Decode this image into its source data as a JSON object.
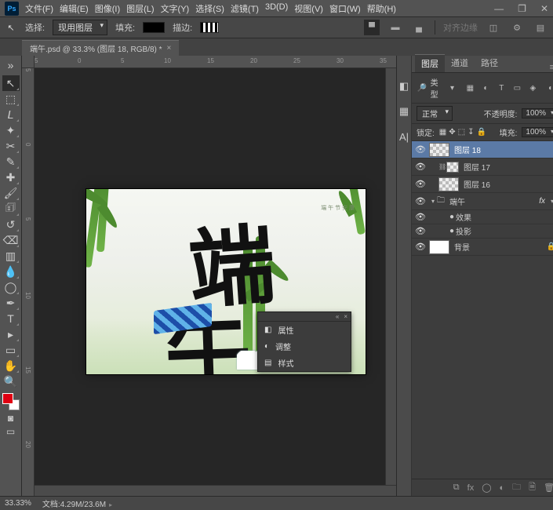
{
  "app": {
    "logo": "Ps"
  },
  "menu": [
    "文件(F)",
    "编辑(E)",
    "图像(I)",
    "图层(L)",
    "文字(Y)",
    "选择(S)",
    "滤镜(T)",
    "3D(D)",
    "视图(V)",
    "窗口(W)",
    "帮助(H)"
  ],
  "window_controls": {
    "min": "—",
    "restore": "❐",
    "close": "✕"
  },
  "options": {
    "select_label": "选择:",
    "select_value": "现用图层",
    "fill_label": "填充:",
    "stroke_label": "描边:",
    "quick_export": "对齐边缘"
  },
  "doc_tab": {
    "title": "端午.psd @ 33.3% (图层 18, RGB/8) *"
  },
  "ruler_h": [
    "5",
    "0",
    "5",
    "10",
    "15",
    "20",
    "25",
    "30",
    "35"
  ],
  "ruler_v": [
    "5",
    "0",
    "5",
    "10",
    "15",
    "20"
  ],
  "canvas": {
    "char1": "端",
    "char2": "午",
    "sidecol": "端\n午\n节\n安\n康"
  },
  "floater": {
    "items": [
      {
        "icon": "properties-icon",
        "label": "属性"
      },
      {
        "icon": "adjustments-icon",
        "label": "调整"
      },
      {
        "icon": "styles-icon",
        "label": "样式"
      }
    ]
  },
  "dock_strip": [
    {
      "name": "color-picker-icon",
      "glyph": "◧"
    },
    {
      "name": "swatches-icon",
      "glyph": "▦"
    },
    {
      "name": "type-icon",
      "glyph": "A|"
    }
  ],
  "panel_tabs": [
    "图层",
    "通道",
    "路径"
  ],
  "layer_opts": {
    "kind_label": "类型",
    "blend_mode": "正常",
    "opacity_label": "不透明度:",
    "opacity_value": "100%",
    "lock_label": "锁定:",
    "fill_label": "填充:",
    "fill_value": "100%"
  },
  "filter_icons": [
    {
      "name": "filter-pixel-icon",
      "glyph": "▦"
    },
    {
      "name": "filter-adjust-icon",
      "glyph": "◐"
    },
    {
      "name": "filter-type-icon",
      "glyph": "T"
    },
    {
      "name": "filter-shape-icon",
      "glyph": "▭"
    },
    {
      "name": "filter-smart-icon",
      "glyph": "◈"
    }
  ],
  "lock_icons": [
    {
      "name": "lock-pixels-icon",
      "glyph": "▦"
    },
    {
      "name": "lock-position-icon",
      "glyph": "✥"
    },
    {
      "name": "lock-artboard-icon",
      "glyph": "⬚"
    },
    {
      "name": "lock-nested-icon",
      "glyph": "↧"
    },
    {
      "name": "lock-all-icon",
      "glyph": "🔒"
    }
  ],
  "layers": [
    {
      "vis": true,
      "sel": true,
      "indent": 0,
      "thumb": "checker",
      "name": "图层 18"
    },
    {
      "vis": true,
      "indent": 1,
      "link": true,
      "thumb": "small",
      "name": "图层 17"
    },
    {
      "vis": true,
      "indent": 1,
      "thumb": "checker",
      "name": "图层 16"
    },
    {
      "vis": true,
      "indent": 0,
      "twirl": "▾",
      "folder": true,
      "name": "端午",
      "fx": true,
      "fxopen": "▾"
    },
    {
      "vis": true,
      "sub": true,
      "indent": 2,
      "dot": true,
      "name": "效果"
    },
    {
      "vis": true,
      "sub": true,
      "indent": 2,
      "dot": true,
      "name": "投影"
    },
    {
      "vis": true,
      "indent": 0,
      "thumb": "white",
      "name": "背景",
      "locked": true
    }
  ],
  "panel_footer": [
    {
      "name": "link-layers-icon",
      "glyph": "⧉"
    },
    {
      "name": "fx-icon",
      "glyph": "fx"
    },
    {
      "name": "mask-icon",
      "glyph": "◯"
    },
    {
      "name": "adjustment-layer-icon",
      "glyph": "◐"
    },
    {
      "name": "group-icon",
      "glyph": "🗀"
    },
    {
      "name": "new-layer-icon",
      "glyph": "🗎"
    },
    {
      "name": "delete-icon",
      "glyph": "🗑"
    }
  ],
  "status": {
    "zoom": "33.33%",
    "docinfo": "文档:4.29M/23.6M"
  },
  "tools": [
    {
      "name": "move-tool",
      "glyph": "↖",
      "sel": true,
      "corner": true
    },
    {
      "name": "marquee-tool",
      "glyph": "⬚",
      "corner": true
    },
    {
      "name": "lasso-tool",
      "glyph": "𝘓",
      "corner": true
    },
    {
      "name": "quick-select-tool",
      "glyph": "✦",
      "corner": true
    },
    {
      "name": "crop-tool",
      "glyph": "✂",
      "corner": true
    },
    {
      "name": "eyedropper-tool",
      "glyph": "✎",
      "corner": true
    },
    {
      "name": "spot-heal-tool",
      "glyph": "✚",
      "corner": true
    },
    {
      "name": "brush-tool",
      "glyph": "🖌",
      "corner": true
    },
    {
      "name": "clone-stamp-tool",
      "glyph": "🗊",
      "corner": true
    },
    {
      "name": "history-brush-tool",
      "glyph": "↺",
      "corner": true
    },
    {
      "name": "eraser-tool",
      "glyph": "⌫",
      "corner": true
    },
    {
      "name": "gradient-tool",
      "glyph": "▥",
      "corner": true
    },
    {
      "name": "blur-tool",
      "glyph": "💧",
      "corner": true
    },
    {
      "name": "dodge-tool",
      "glyph": "◯",
      "corner": true
    },
    {
      "name": "pen-tool",
      "glyph": "✒",
      "corner": true
    },
    {
      "name": "type-tool",
      "glyph": "T",
      "corner": true
    },
    {
      "name": "path-select-tool",
      "glyph": "▸",
      "corner": true
    },
    {
      "name": "rectangle-tool",
      "glyph": "▭",
      "corner": true
    },
    {
      "name": "hand-tool",
      "glyph": "✋",
      "corner": true
    },
    {
      "name": "zoom-tool",
      "glyph": "🔍"
    }
  ]
}
